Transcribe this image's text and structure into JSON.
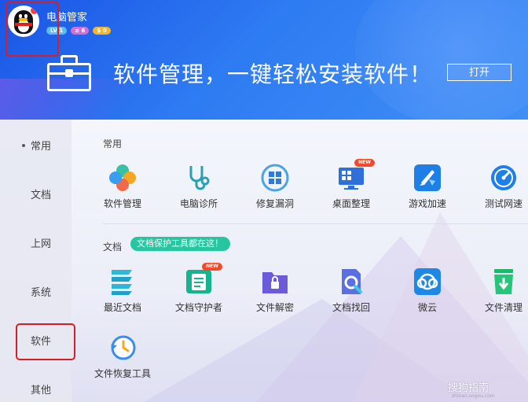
{
  "user": {
    "name": "电脑管家",
    "badges": [
      "LV 1",
      "≡ 6",
      "$ 0"
    ]
  },
  "banner": {
    "slogan": "软件管理，一键轻松安装软件！",
    "open_button": "打开"
  },
  "sidebar": {
    "items": [
      {
        "label": "常用",
        "active": true
      },
      {
        "label": "文档"
      },
      {
        "label": "上网"
      },
      {
        "label": "系统"
      },
      {
        "label": "软件"
      },
      {
        "label": "其他"
      }
    ]
  },
  "sections": {
    "common": {
      "title": "常用",
      "apps": [
        {
          "label": "软件管理",
          "icon": "clover-icon"
        },
        {
          "label": "电脑诊所",
          "icon": "stethoscope-icon"
        },
        {
          "label": "修复漏洞",
          "icon": "windows-repair-icon"
        },
        {
          "label": "桌面整理",
          "icon": "desktop-monitor-icon",
          "new": "NEW"
        },
        {
          "label": "游戏加速",
          "icon": "game-boost-icon"
        },
        {
          "label": "测试网速",
          "icon": "speedometer-icon"
        }
      ]
    },
    "docs": {
      "title": "文档",
      "tag": "文档保护工具都在这！",
      "apps": [
        {
          "label": "最近文档",
          "icon": "recent-docs-icon"
        },
        {
          "label": "文档守护者",
          "icon": "doc-guardian-icon",
          "new": "NEW"
        },
        {
          "label": "文件解密",
          "icon": "folder-lock-icon"
        },
        {
          "label": "文档找回",
          "icon": "doc-search-icon"
        },
        {
          "label": "微云",
          "icon": "weiyun-cloud-icon"
        },
        {
          "label": "文件清理",
          "icon": "file-clean-icon"
        },
        {
          "label": "文件恢复工具",
          "icon": "file-restore-icon"
        }
      ]
    }
  },
  "watermark": {
    "text": "搜狗指南",
    "sub": "zhinan.sogou.com"
  },
  "colors": {
    "header_blue": "#2e7bf2",
    "tag_green": "#26c7a0",
    "highlight_red": "#d81e25"
  }
}
